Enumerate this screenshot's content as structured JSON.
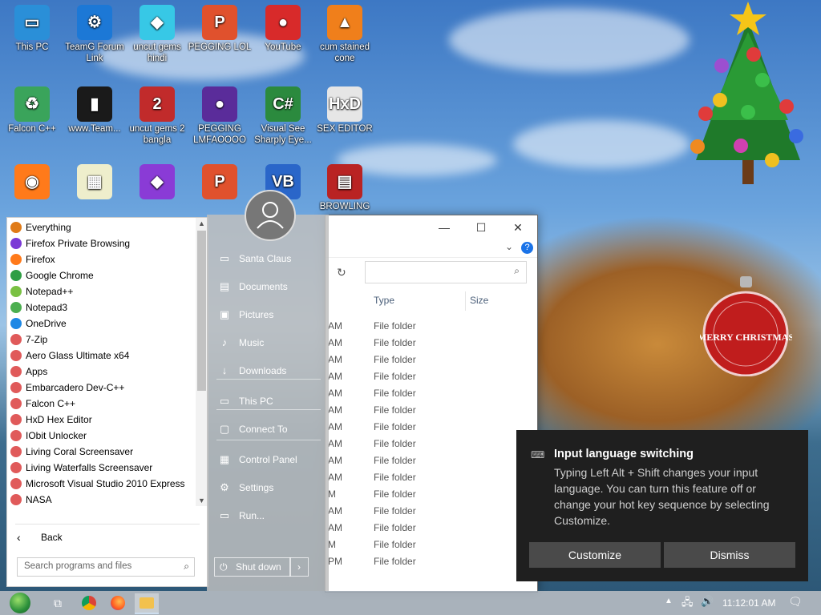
{
  "desktop_icons": [
    {
      "label": "This PC",
      "color": "#2a8fd8",
      "glyph": "▭"
    },
    {
      "label": "TeamG Forum Link",
      "color": "#1c78d6",
      "glyph": "⚙"
    },
    {
      "label": "uncut gems hindi",
      "color": "#37c8e6",
      "glyph": "◆"
    },
    {
      "label": "PEGGING LOL",
      "color": "#e0512d",
      "glyph": "P"
    },
    {
      "label": "YouTube",
      "color": "#d82a2a",
      "glyph": "●"
    },
    {
      "label": "cum stained cone",
      "color": "#f07f1b",
      "glyph": "▲"
    },
    {
      "label": "Falcon C++",
      "color": "#3aa45b",
      "glyph": "♻"
    },
    {
      "label": "www.Team...",
      "color": "#1a1a1a",
      "glyph": "▮"
    },
    {
      "label": "uncut gems 2 bangla",
      "color": "#c12b2b",
      "glyph": "2"
    },
    {
      "label": "PEGGING LMFAOOOO",
      "color": "#5a2c9a",
      "glyph": "●"
    },
    {
      "label": "Visual See Sharply Eye...",
      "color": "#2b8a3e",
      "glyph": "C#"
    },
    {
      "label": "SEX EDITOR",
      "color": "#e6e6e6",
      "glyph": "HxD"
    },
    {
      "label": "",
      "color": "#ff7a1a",
      "glyph": "◉"
    },
    {
      "label": "",
      "color": "#eeeecc",
      "glyph": "▦"
    },
    {
      "label": "",
      "color": "#8a3bd6",
      "glyph": "◆"
    },
    {
      "label": "",
      "color": "#e0512d",
      "glyph": "P"
    },
    {
      "label": "",
      "color": "#2a66c9",
      "glyph": "VB"
    },
    {
      "label": "BROWLING",
      "color": "#b92323",
      "glyph": "▤"
    }
  ],
  "explorer": {
    "columns": [
      "Type",
      "Size"
    ],
    "rows": [
      {
        "time": "AM",
        "type": "File folder"
      },
      {
        "time": "AM",
        "type": "File folder"
      },
      {
        "time": "AM",
        "type": "File folder"
      },
      {
        "time": "AM",
        "type": "File folder"
      },
      {
        "time": "AM",
        "type": "File folder"
      },
      {
        "time": "AM",
        "type": "File folder"
      },
      {
        "time": "AM",
        "type": "File folder"
      },
      {
        "time": "AM",
        "type": "File folder"
      },
      {
        "time": "AM",
        "type": "File folder"
      },
      {
        "time": "AM",
        "type": "File folder"
      },
      {
        "time": "M",
        "type": "File folder"
      },
      {
        "time": "AM",
        "type": "File folder"
      },
      {
        "time": "AM",
        "type": "File folder"
      },
      {
        "time": "M",
        "type": "File folder"
      },
      {
        "time": "PM",
        "type": "File folder"
      }
    ]
  },
  "start_menu": {
    "programs": [
      {
        "label": "Everything",
        "color": "#e07b18"
      },
      {
        "label": "Firefox Private Browsing",
        "color": "#7b3ad6"
      },
      {
        "label": "Firefox",
        "color": "#ff7a1a"
      },
      {
        "label": "Google Chrome",
        "color": "#2f9e44"
      },
      {
        "label": "Notepad++",
        "color": "#7ac143"
      },
      {
        "label": "Notepad3",
        "color": "#4caf50"
      },
      {
        "label": "OneDrive",
        "color": "#1e88e5"
      },
      {
        "label": "7-Zip",
        "color": "#e05a5a"
      },
      {
        "label": "Aero Glass Ultimate x64",
        "color": "#e05a5a"
      },
      {
        "label": "Apps",
        "color": "#e05a5a"
      },
      {
        "label": "Embarcadero Dev-C++",
        "color": "#e05a5a"
      },
      {
        "label": "Falcon C++",
        "color": "#e05a5a"
      },
      {
        "label": "HxD Hex Editor",
        "color": "#e05a5a"
      },
      {
        "label": "IObit Unlocker",
        "color": "#e05a5a"
      },
      {
        "label": "Living Coral Screensaver",
        "color": "#e05a5a"
      },
      {
        "label": "Living Waterfalls Screensaver",
        "color": "#e05a5a"
      },
      {
        "label": "Microsoft Visual Studio 2010 Express",
        "color": "#e05a5a"
      },
      {
        "label": "NASA",
        "color": "#e05a5a"
      }
    ],
    "back_label": "Back",
    "search_placeholder": "Search programs and files",
    "right_items": [
      {
        "label": "Santa Claus",
        "icon": "▭"
      },
      {
        "label": "Documents",
        "icon": "▤"
      },
      {
        "label": "Pictures",
        "icon": "▣"
      },
      {
        "label": "Music",
        "icon": "♪"
      },
      {
        "label": "Downloads",
        "icon": "↓"
      },
      {
        "label": "This PC",
        "icon": "▭"
      },
      {
        "label": "Connect To",
        "icon": "▢"
      },
      {
        "label": "Control Panel",
        "icon": "▦"
      },
      {
        "label": "Settings",
        "icon": "⚙"
      },
      {
        "label": "Run...",
        "icon": "▭"
      }
    ],
    "shutdown_label": "Shut down"
  },
  "toast": {
    "title": "Input language switching",
    "body": "Typing Left Alt + Shift changes your input language. You can turn this feature off or change your hot key sequence by selecting Customize.",
    "customize_label": "Customize",
    "dismiss_label": "Dismiss"
  },
  "ornament_text": "MERRY CHRISTMAS",
  "taskbar": {
    "clock": "11:12:01 AM"
  }
}
